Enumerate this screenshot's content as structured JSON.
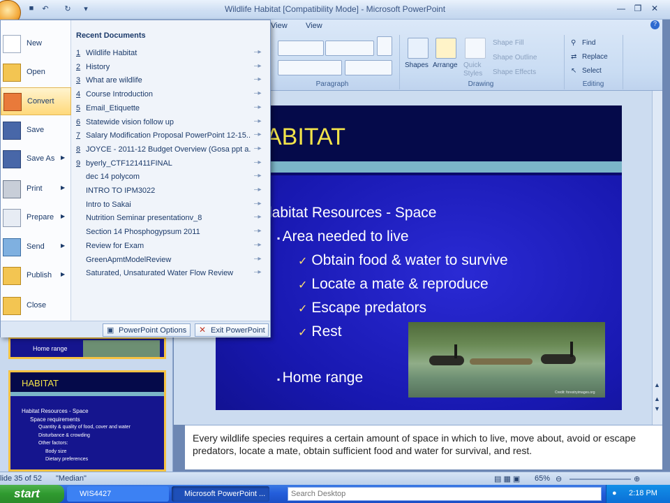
{
  "window": {
    "title": "Wildlife Habitat [Compatibility Mode] - Microsoft PowerPoint"
  },
  "ribbon": {
    "tabs": [
      "View",
      "View"
    ],
    "groups": [
      "Paragraph",
      "Drawing",
      "Editing"
    ],
    "drawing": {
      "shapes_label": "Shapes",
      "arrange_label": "Arrange",
      "quick_styles_label": "Quick Styles",
      "shape_fill": "Shape Fill",
      "shape_outline": "Shape Outline",
      "shape_effects": "Shape Effects"
    },
    "editing": {
      "find": "Find",
      "replace": "Replace",
      "select": "Select"
    }
  },
  "office_menu": {
    "items": [
      {
        "label": "New",
        "icon": "new-document-icon"
      },
      {
        "label": "Open",
        "icon": "folder-open-icon"
      },
      {
        "label": "Convert",
        "icon": "convert-icon"
      },
      {
        "label": "Save",
        "icon": "save-disk-icon"
      },
      {
        "label": "Save As",
        "icon": "save-as-icon"
      },
      {
        "label": "Print",
        "icon": "printer-icon"
      },
      {
        "label": "Prepare",
        "icon": "prepare-icon"
      },
      {
        "label": "Send",
        "icon": "send-icon"
      },
      {
        "label": "Publish",
        "icon": "publish-icon"
      },
      {
        "label": "Close",
        "icon": "close-folder-icon"
      }
    ],
    "recent_header": "Recent Documents",
    "recent": [
      {
        "num": "1",
        "name": "Wildlife Habitat"
      },
      {
        "num": "2",
        "name": "History"
      },
      {
        "num": "3",
        "name": "What are wildlife"
      },
      {
        "num": "4",
        "name": "Course Introduction"
      },
      {
        "num": "5",
        "name": "Email_Etiquette"
      },
      {
        "num": "6",
        "name": "Statewide vision follow up"
      },
      {
        "num": "7",
        "name": "Salary Modification Proposal PowerPoint 12-15..."
      },
      {
        "num": "8",
        "name": "JOYCE - 2011-12 Budget Overview (Gosa ppt a..."
      },
      {
        "num": "9",
        "name": "byerly_CTF121411FINAL"
      },
      {
        "num": "",
        "name": "dec 14 polycom"
      },
      {
        "num": "",
        "name": "INTRO TO IPM3022"
      },
      {
        "num": "",
        "name": "Intro to Sakai"
      },
      {
        "num": "",
        "name": "Nutrition Seminar presentationv_8"
      },
      {
        "num": "",
        "name": "Section 14 Phosphogypsum 2011"
      },
      {
        "num": "",
        "name": "Review for Exam"
      },
      {
        "num": "",
        "name": "GreenApmtModelReview"
      },
      {
        "num": "",
        "name": "Saturated, Unsaturated Water Flow Review"
      }
    ],
    "options_button": "PowerPoint Options",
    "exit_button": "Exit PowerPoint"
  },
  "thumbnails": {
    "upper_text": "Home range",
    "lower_title": "HABITAT",
    "lower_lines": [
      "Habitat Resources - Space",
      "Space requirements",
      "Quantity & quality of food, cover and water",
      "Disturbance & crowding",
      "Other factors:",
      "Body size",
      "Dietary preferences"
    ]
  },
  "slide": {
    "title": "ABITAT",
    "level1": "labitat Resources - Space",
    "level2a": "Area needed to live",
    "checks": [
      "Obtain food & water to survive",
      "Locate a mate & reproduce",
      "Escape predators",
      "Rest"
    ],
    "level2b": "Home range",
    "photo_credit": "Credit: forestryimages.org"
  },
  "notes": {
    "text": "Every wildlife species requires a certain amount of space in which to live, move about, avoid or escape predators, locate a mate, obtain sufficient food and water for survival, and rest."
  },
  "status": {
    "slide_info": "lide 35 of 52",
    "theme": "\"Median\"",
    "zoom": "65%"
  },
  "taskbar": {
    "start": "start",
    "tasks": [
      "WIS4427",
      "Microsoft PowerPoint ..."
    ],
    "search_placeholder": "Search Desktop",
    "clock": "2:18 PM"
  }
}
